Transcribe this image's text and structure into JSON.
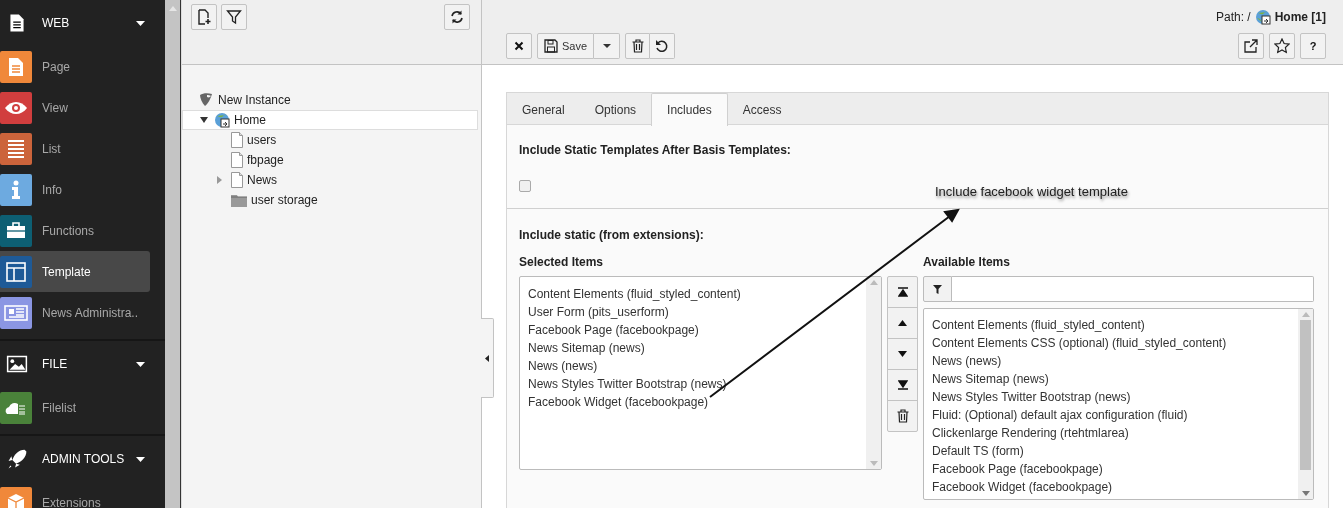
{
  "module_menu": [
    {
      "title": "WEB",
      "items": [
        {
          "label": "Page",
          "color": "#f0883a",
          "selected": false
        },
        {
          "label": "View",
          "color": "#d13e3e",
          "selected": false
        },
        {
          "label": "List",
          "color": "#cc643b",
          "selected": false
        },
        {
          "label": "Info",
          "color": "#6daae0",
          "selected": false
        },
        {
          "label": "Functions",
          "color": "#0d5f73",
          "selected": false
        },
        {
          "label": "Template",
          "color": "#1e5a97",
          "selected": true
        },
        {
          "label": "News Administra..",
          "color": "#8b96e3",
          "selected": false
        }
      ]
    },
    {
      "title": "FILE",
      "items": [
        {
          "label": "Filelist",
          "color": "#4a823a",
          "selected": false
        }
      ]
    },
    {
      "title": "ADMIN TOOLS",
      "items": [
        {
          "label": "Extensions",
          "color": "#f0883a",
          "selected": false
        }
      ]
    }
  ],
  "page_tree": {
    "items": [
      {
        "label": "New Instance",
        "kind": "root",
        "selected": false,
        "children": [
          {
            "label": "Home",
            "kind": "site",
            "selected": true,
            "expanded": true,
            "children": [
              {
                "label": "users",
                "kind": "page",
                "selected": false
              },
              {
                "label": "fbpage",
                "kind": "page",
                "selected": false
              },
              {
                "label": "News",
                "kind": "page",
                "selected": false,
                "expanded": false
              },
              {
                "label": "user storage",
                "kind": "folder",
                "selected": false
              }
            ]
          }
        ]
      }
    ]
  },
  "header": {
    "path_label": "Path: /",
    "path_page": "Home [1]",
    "save_button": "Save",
    "help_button": "?"
  },
  "tabs": [
    {
      "label": "General",
      "selected": false
    },
    {
      "label": "Options",
      "selected": false
    },
    {
      "label": "Includes",
      "selected": true
    },
    {
      "label": "Access",
      "selected": false
    }
  ],
  "static_after_basis": {
    "label": "Include Static Templates After Basis Templates:",
    "checked": false
  },
  "include_static": {
    "label": "Include static (from extensions):",
    "selected_title": "Selected Items",
    "available_title": "Available Items",
    "selected_items": [
      "Content Elements (fluid_styled_content)",
      "User Form (pits_userform)",
      "Facebook Page (facebookpage)",
      "News Sitemap (news)",
      "News (news)",
      "News Styles Twitter Bootstrap (news)",
      "Facebook Widget (facebookpage)"
    ],
    "available_items": [
      "Content Elements (fluid_styled_content)",
      "Content Elements CSS (optional) (fluid_styled_content)",
      "News (news)",
      "News Sitemap (news)",
      "News Styles Twitter Bootstrap (news)",
      "Fluid: (Optional) default ajax configuration (fluid)",
      "Clickenlarge Rendering (rtehtmlarea)",
      "Default TS (form)",
      "Facebook Page (facebookpage)",
      "Facebook Widget (facebookpage)"
    ]
  },
  "annotation": {
    "text": "Include facebook widget template"
  }
}
